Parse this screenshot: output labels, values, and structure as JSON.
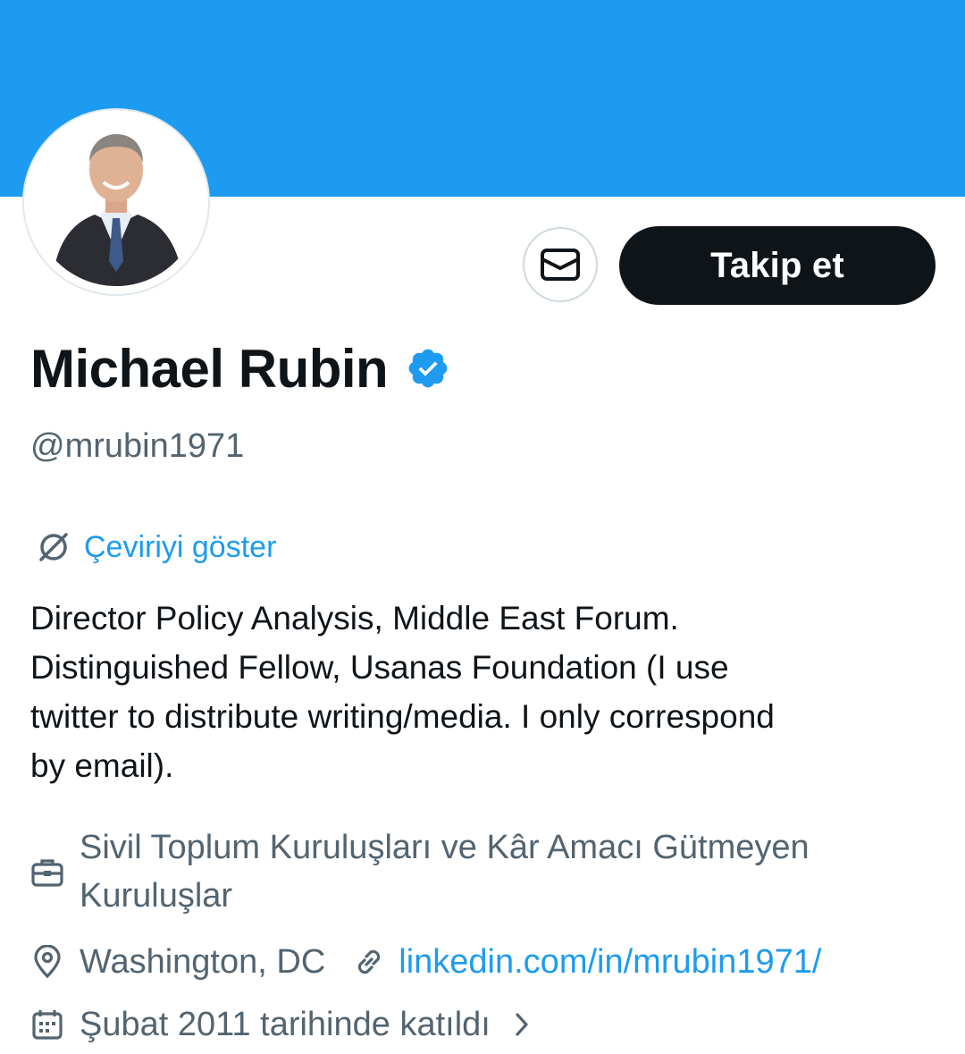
{
  "profile": {
    "name": "Michael Rubin",
    "handle": "@mrubin1971",
    "verified": true,
    "translate_label": "Çeviriyi göster",
    "bio": "Director Policy Analysis, Middle East Forum.\nDistinguished Fellow, Usanas Foundation  (I use\ntwitter to distribute writing/media. I only correspond\nby email).",
    "category": "Sivil Toplum Kuruluşları ve Kâr Amacı Gütmeyen Kuruluşlar",
    "location": "Washington, DC",
    "website": "linkedin.com/in/mrubin1971/",
    "joined": "Şubat 2011 tarihinde katıldı"
  },
  "actions": {
    "message_icon": "envelope-icon",
    "follow_label": "Takip et"
  },
  "icons": {
    "translate": "translate-globe-icon",
    "category": "briefcase-icon",
    "location": "location-pin-icon",
    "link": "link-icon",
    "joined": "calendar-icon",
    "more": "chevron-right-icon",
    "verified": "verified-badge-icon"
  },
  "colors": {
    "banner": "#1d9bf0",
    "accent": "#1d9bf0",
    "text_primary": "#0f1419",
    "text_secondary": "#536471",
    "button_dark": "#0f1419"
  }
}
